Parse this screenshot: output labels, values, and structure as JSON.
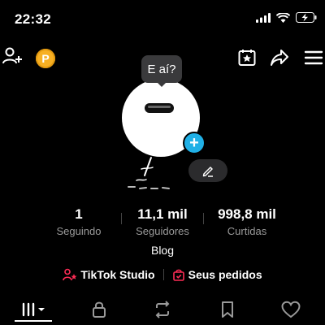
{
  "status_bar": {
    "time": "22:32"
  },
  "bubble": {
    "text": "E aí?"
  },
  "stats": [
    {
      "value": "1",
      "label": "Seguindo"
    },
    {
      "value": "11,1 mil",
      "label": "Seguidores"
    },
    {
      "value": "998,8 mil",
      "label": "Curtidas"
    }
  ],
  "bio": "Blog",
  "links": {
    "studio": "TikTok Studio",
    "orders": "Seus pedidos"
  },
  "coin": {
    "letter": "P"
  },
  "colors": {
    "accent_blue": "#20b0e6",
    "coin": "#f7b023",
    "studio_red": "#fe2c55"
  },
  "icons": {
    "top_bar": [
      "add-friend-icon",
      "coin-icon",
      "calendar-star-icon",
      "share-icon",
      "menu-icon"
    ],
    "tabs": [
      "grid-icon",
      "lock-icon",
      "repost-icon",
      "bookmark-icon",
      "heart-icon"
    ]
  }
}
